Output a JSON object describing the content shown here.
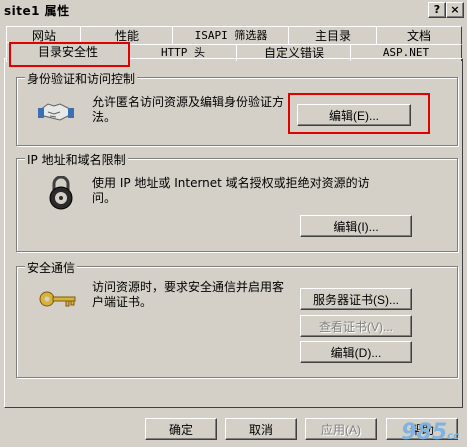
{
  "window": {
    "title": "site1 属性",
    "help_glyph": "?",
    "close_glyph": "×"
  },
  "tabs_row1": [
    "网站",
    "性能",
    "ISAPI 筛选器",
    "主目录",
    "文档"
  ],
  "tabs_row2": [
    "目录安全性",
    "HTTP 头",
    "自定义错误",
    "ASP.NET"
  ],
  "auth": {
    "legend": "身份验证和访问控制",
    "description": "允许匿名访问资源及编辑身份验证方法。",
    "edit_button": "编辑(E)..."
  },
  "ip": {
    "legend": "IP 地址和域名限制",
    "description": "使用 IP 地址或 Internet 域名授权或拒绝对资源的访问。",
    "edit_button": "编辑(I)..."
  },
  "secure": {
    "legend": "安全通信",
    "description": "访问资源时，要求安全通信并启用客户端证书。",
    "server_cert_button": "服务器证书(S)...",
    "view_cert_button": "查看证书(V)...",
    "edit_button": "编辑(D)..."
  },
  "footer": {
    "ok": "确定",
    "cancel": "取消",
    "apply": "应用(A)",
    "help": "帮助"
  },
  "watermark": {
    "main": "985",
    "suffix": "cc"
  },
  "colors": {
    "face": "#d4d0c8",
    "highlight_box": "#e00000"
  }
}
